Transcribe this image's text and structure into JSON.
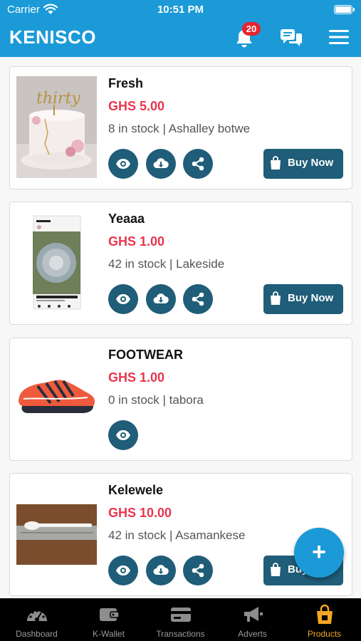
{
  "status_bar": {
    "carrier": "Carrier",
    "time": "10:51 PM"
  },
  "header": {
    "brand": "KENISCO",
    "notification_count": "20"
  },
  "products": [
    {
      "name": "Fresh",
      "price": "GHS 5.00",
      "stock": "8 in stock | Ashalley botwe",
      "image": "cake",
      "actions": [
        "view",
        "download",
        "share"
      ],
      "buy_label": "Buy Now"
    },
    {
      "name": "Yeaaa",
      "price": "GHS 1.00",
      "stock": "42 in stock | Lakeside",
      "image": "instagram-screenshot",
      "actions": [
        "view",
        "download",
        "share"
      ],
      "buy_label": "Buy Now"
    },
    {
      "name": "FOOTWEAR",
      "price": "GHS 1.00",
      "stock": "0 in stock | tabora",
      "image": "sneaker",
      "actions": [
        "view"
      ],
      "buy_label": ""
    },
    {
      "name": "Kelewele",
      "price": "GHS 10.00",
      "stock": "42 in stock | Asamankese",
      "image": "spoon",
      "actions": [
        "view",
        "download",
        "share"
      ],
      "buy_label": "Buy Now"
    }
  ],
  "fab": {
    "label": "+"
  },
  "tabs": [
    {
      "label": "Dashboard",
      "icon": "gauge-icon",
      "active": false
    },
    {
      "label": "K-Wallet",
      "icon": "wallet-icon",
      "active": false
    },
    {
      "label": "Transactions",
      "icon": "card-icon",
      "active": false
    },
    {
      "label": "Adverts",
      "icon": "megaphone-icon",
      "active": false
    },
    {
      "label": "Products",
      "icon": "shopping-bag-icon",
      "active": true
    }
  ],
  "colors": {
    "primary": "#1b9ad7",
    "action": "#1f5d78",
    "price": "#e8364f",
    "active_tab": "#f5a623",
    "badge": "#e8232e"
  }
}
